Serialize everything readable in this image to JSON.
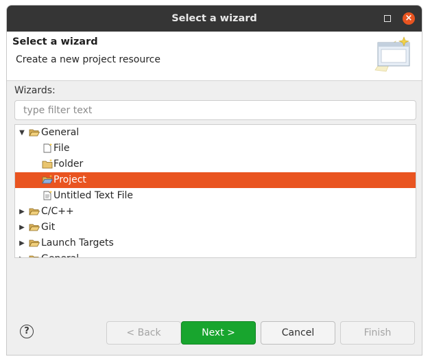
{
  "window": {
    "title": "Select a wizard"
  },
  "header": {
    "title": "Select a wizard",
    "description": "Create a new project resource"
  },
  "wizards_label": "Wizards:",
  "filter": {
    "placeholder": "type filter text",
    "value": ""
  },
  "tree": [
    {
      "label": "General",
      "expanded": true,
      "icon": "open-folder-icon"
    },
    {
      "label": "File",
      "icon": "new-file-icon"
    },
    {
      "label": "Folder",
      "icon": "new-folder-icon"
    },
    {
      "label": "Project",
      "icon": "new-project-icon",
      "selected": true
    },
    {
      "label": "Untitled Text File",
      "icon": "text-file-icon"
    },
    {
      "label": "C/C++",
      "expanded": false,
      "icon": "folder-icon"
    },
    {
      "label": "Git",
      "expanded": false,
      "icon": "folder-icon"
    },
    {
      "label": "Launch Targets",
      "expanded": false,
      "icon": "folder-icon"
    },
    {
      "label": "General",
      "expanded": false,
      "icon": "folder-icon"
    }
  ],
  "buttons": {
    "help": "?",
    "back": "< Back",
    "next": "Next >",
    "cancel": "Cancel",
    "finish": "Finish"
  },
  "colors": {
    "selection": "#e95420",
    "primary_button": "#18a52e",
    "titlebar": "#353535"
  }
}
